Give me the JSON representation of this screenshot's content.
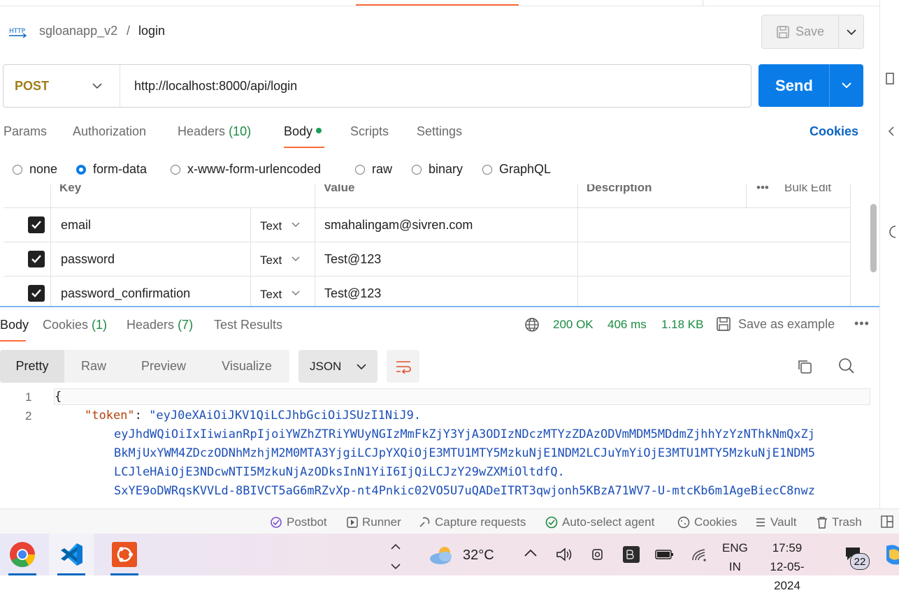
{
  "breadcrumb": {
    "collection": "sgloanapp_v2",
    "separator": "/",
    "request": "login",
    "icon_text": "HTTP"
  },
  "save": {
    "label": "Save"
  },
  "request": {
    "method": "POST",
    "url": "http://localhost:8000/api/login",
    "send_label": "Send"
  },
  "request_tabs": {
    "params": "Params",
    "authorization": "Authorization",
    "headers": "Headers",
    "headers_count": "(10)",
    "body": "Body",
    "scripts": "Scripts",
    "settings": "Settings",
    "cookies": "Cookies"
  },
  "body_types": {
    "none": "none",
    "form_data": "form-data",
    "urlencoded": "x-www-form-urlencoded",
    "raw": "raw",
    "binary": "binary",
    "graphql": "GraphQL",
    "selected": "form-data"
  },
  "form_table": {
    "headers": {
      "key": "Key",
      "value": "Value",
      "description": "Description",
      "bulk_edit": "Bulk Edit"
    },
    "rows": [
      {
        "key": "email",
        "type": "Text",
        "value": "smahalingam@sivren.com",
        "checked": true
      },
      {
        "key": "password",
        "type": "Text",
        "value": "Test@123",
        "checked": true
      },
      {
        "key": "password_confirmation",
        "type": "Text",
        "value": "Test@123",
        "checked": true
      }
    ]
  },
  "response_tabs": {
    "body": "Body",
    "cookies": "Cookies",
    "cookies_count": "(1)",
    "headers": "Headers",
    "headers_count": "(7)",
    "test_results": "Test Results"
  },
  "response_meta": {
    "status": "200 OK",
    "time": "406 ms",
    "size": "1.18 KB",
    "save_example": "Save as example",
    "more": "•••"
  },
  "view_modes": {
    "pretty": "Pretty",
    "raw": "Raw",
    "preview": "Preview",
    "visualize": "Visualize",
    "format": "JSON"
  },
  "code": {
    "line_numbers": [
      "1",
      "2"
    ],
    "open_brace": "{",
    "token_key": "\"token\"",
    "colon": ": ",
    "token_lines": [
      "\"eyJ0eXAiOiJKV1QiLCJhbGciOiJSUzI1NiJ9.",
      "eyJhdWQiOiIxIiwianRpIjoiYWZhZTRiYWUyNGIzMmFkZjY3YjA3ODIzNDczMTYzZDAzODVmMDM5MDdmZjhhYzYzNThkNmQxZj",
      "BkMjUxYWM4ZDczODNhMzhjM2M0MTA3YjgiLCJpYXQiOjE3MTU1MTY5MzkuNjE1NDM2LCJuYmYiOjE3MTU1MTY5MzkuNjE1NDM5",
      "LCJleHAiOjE3NDcwNTI5MzkuNjAzODksInN1YiI6IjQiLCJzY29wZXMiOltdfQ.",
      "SxYE9oDWRqsKVVLd-8BIVCT5aG6mRZvXp-nt4Pnkic02VO5U7uQADeITRT3qwjonh5KBzA71WV7-U-mtcKb6m1AgeBiecC8nwz"
    ]
  },
  "status_bar": {
    "postbot": "Postbot",
    "runner": "Runner",
    "capture": "Capture requests",
    "auto_select": "Auto-select agent",
    "cookies": "Cookies",
    "vault": "Vault",
    "trash": "Trash"
  },
  "taskbar": {
    "temperature": "32°C",
    "lang_1": "ENG",
    "lang_2": "IN",
    "time": "17:59",
    "date": "12-05-2024",
    "notifications": "22"
  },
  "colors": {
    "accent": "#ff6c37",
    "send": "#0a7ce8",
    "method": "#a17e18",
    "status_ok": "#1c8a42",
    "json_key": "#b5410b",
    "json_string": "#1c4fb8"
  }
}
